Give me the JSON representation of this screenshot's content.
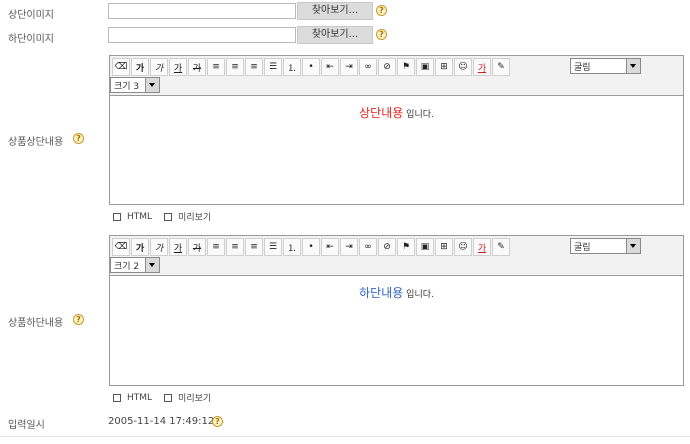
{
  "fields": {
    "top_image": {
      "label": "상단이미지",
      "browse": "찾아보기..."
    },
    "bottom_image": {
      "label": "하단이미지",
      "browse": "찾아보기..."
    },
    "top_content": {
      "label": "상품상단내용",
      "font_select": "굴림",
      "size_select": "크기 3",
      "content_highlight": "상단내용",
      "content_highlight_color": "#e8251f",
      "content_tail": " 입니다.",
      "html_checkbox": "HTML",
      "preview_checkbox": "미리보기"
    },
    "bottom_content": {
      "label": "상품하단내용",
      "font_select": "굴림",
      "size_select": "크기 2",
      "content_highlight": "하단내용",
      "content_highlight_color": "#2f63c7",
      "content_tail": " 입니다.",
      "html_checkbox": "HTML",
      "preview_checkbox": "미리보기"
    },
    "entry_date": {
      "label": "입력일시",
      "value": "2005-11-14 17:49:12"
    }
  },
  "toolbar_icons": [
    "eraser-icon",
    "bold-icon",
    "italic-icon",
    "underline-icon",
    "strikethrough-icon",
    "align-left-icon",
    "align-center-icon",
    "align-right-icon",
    "align-justify-icon",
    "ordered-list-icon",
    "unordered-list-icon",
    "outdent-icon",
    "indent-icon",
    "link-icon",
    "unlink-icon",
    "flag-icon",
    "image-icon",
    "table-icon",
    "emoticon-icon",
    "font-color-icon",
    "highlight-icon"
  ]
}
